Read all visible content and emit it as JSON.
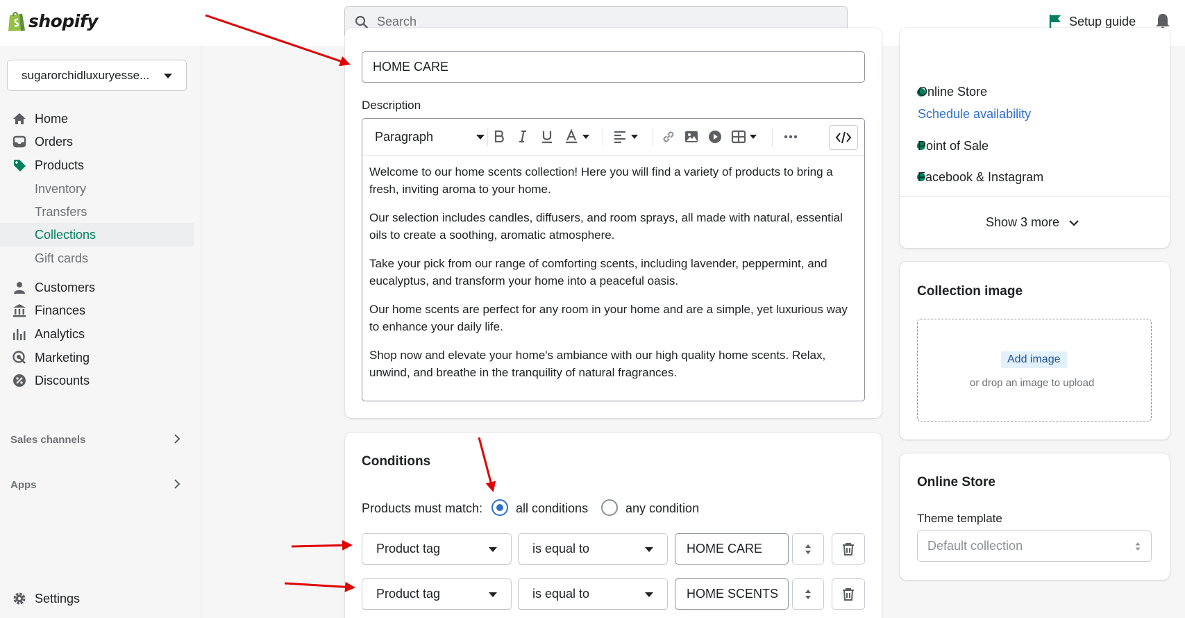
{
  "topbar": {
    "logo_text": "shopify",
    "search_placeholder": "Search",
    "setup_guide": "Setup guide"
  },
  "sidebar": {
    "store_name": "sugarorchidluxuryesse...",
    "items": [
      {
        "label": "Home",
        "icon": "home-icon"
      },
      {
        "label": "Orders",
        "icon": "orders-icon"
      },
      {
        "label": "Products",
        "icon": "tag-icon"
      },
      {
        "label": "Inventory"
      },
      {
        "label": "Transfers"
      },
      {
        "label": "Collections"
      },
      {
        "label": "Gift cards"
      },
      {
        "label": "Customers",
        "icon": "person-icon"
      },
      {
        "label": "Finances",
        "icon": "bank-icon"
      },
      {
        "label": "Analytics",
        "icon": "bar-chart-icon"
      },
      {
        "label": "Marketing",
        "icon": "target-icon"
      },
      {
        "label": "Discounts",
        "icon": "discount-icon"
      }
    ],
    "sales_channels": "Sales channels",
    "apps": "Apps",
    "settings": "Settings"
  },
  "collection": {
    "title_value": "HOME CARE",
    "description_label": "Description",
    "format_select": "Paragraph",
    "paragraphs": [
      "Welcome to our home scents collection! Here you will find a variety of products to bring a fresh, inviting aroma to your home.",
      "Our selection includes candles, diffusers, and room sprays, all made with natural, essential oils to create a soothing, aromatic atmosphere.",
      "Take your pick from our range of comforting scents, including lavender, peppermint, and eucalyptus, and transform your home into a peaceful oasis.",
      "Our home scents are perfect for any room in your home and are a simple, yet luxurious way to enhance your daily life.",
      "Shop now and elevate your home's ambiance with our high quality home scents. Relax, unwind, and breathe in the tranquility of natural fragrances."
    ]
  },
  "conditions": {
    "title": "Conditions",
    "match_label": "Products must match:",
    "option_all": "all conditions",
    "option_any": "any condition",
    "selected": "all conditions",
    "rows": [
      {
        "field": "Product tag",
        "operator": "is equal to",
        "value": "HOME CARE"
      },
      {
        "field": "Product tag",
        "operator": "is equal to",
        "value": "HOME SCENTS"
      }
    ]
  },
  "availability": {
    "channels": [
      {
        "name": "Online Store",
        "link": "Schedule availability"
      },
      {
        "name": "Point of Sale"
      },
      {
        "name": "Facebook & Instagram"
      }
    ],
    "show_more": "Show 3 more"
  },
  "collection_image": {
    "title": "Collection image",
    "add_button": "Add image",
    "hint": "or drop an image to upload"
  },
  "online_store": {
    "title": "Online Store",
    "theme_label": "Theme template",
    "theme_value": "Default collection"
  },
  "colors": {
    "accent_green": "#008060",
    "link_blue": "#2c6ecb",
    "annotation_red": "#e00000"
  }
}
